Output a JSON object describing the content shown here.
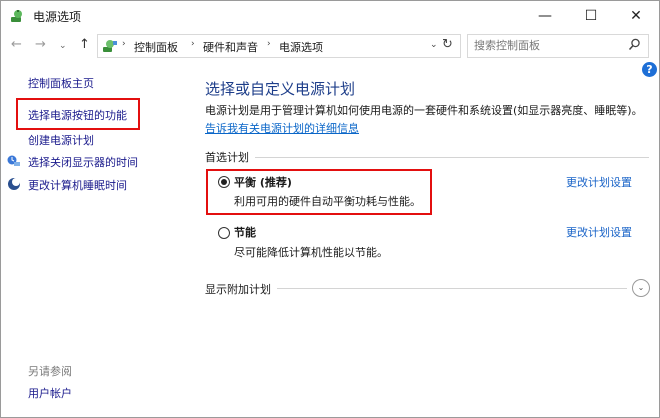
{
  "window": {
    "title": "电源选项",
    "min_glyph": "—",
    "max_glyph": "☐",
    "close_glyph": "✕"
  },
  "nav": {
    "back_glyph": "←",
    "forward_glyph": "→",
    "recent_glyph": "⌄",
    "up_glyph": "↑",
    "breadcrumb": [
      "控制面板",
      "硬件和声音",
      "电源选项"
    ],
    "sep_glyph": "›",
    "dropdown_glyph": "⌄",
    "refresh_glyph": "↻"
  },
  "search": {
    "placeholder": "搜索控制面板"
  },
  "sidebar": {
    "home": "控制面板主页",
    "links": [
      "选择电源按钮的功能",
      "创建电源计划",
      "选择关闭显示器的时间",
      "更改计算机睡眠时间"
    ],
    "see_also_label": "另请参阅",
    "see_also_links": [
      "用户帐户"
    ]
  },
  "main": {
    "help_glyph": "?",
    "title": "选择或自定义电源计划",
    "description": "电源计划是用于管理计算机如何使用电源的一套硬件和系统设置(如显示器亮度、睡眠等)。",
    "description_link": "告诉我有关电源计划的详细信息",
    "preferred_section": "首选计划",
    "plans": [
      {
        "name": "平衡 (推荐)",
        "desc": "利用可用的硬件自动平衡功耗与性能。",
        "selected": true,
        "link": "更改计划设置"
      },
      {
        "name": "节能",
        "desc": "尽可能降低计算机性能以节能。",
        "selected": false,
        "link": "更改计划设置"
      }
    ],
    "more_plans": "显示附加计划",
    "expand_glyph": "⌄"
  },
  "colors": {
    "highlight": "#e30f0f",
    "link": "#1a64c8",
    "title": "#1e3e8a"
  }
}
